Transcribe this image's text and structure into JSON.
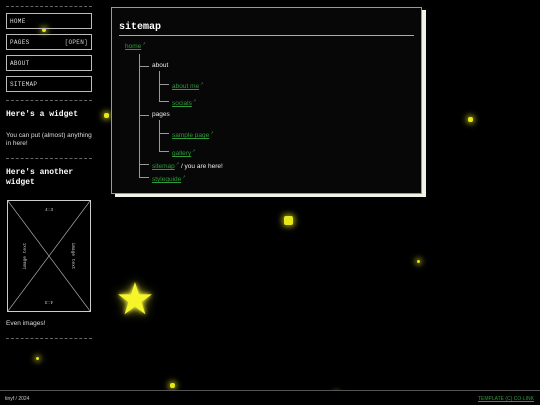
{
  "sidebar": {
    "nav": [
      {
        "label": "HOME",
        "tag": ""
      },
      {
        "label": "PAGES",
        "tag": "[OPEN]"
      },
      {
        "label": "ABOUT",
        "tag": ""
      },
      {
        "label": "SITEMAP",
        "tag": ""
      }
    ],
    "widget1": {
      "title": "Here's a widget",
      "text": "You can put (almost) anything in here!"
    },
    "widget2": {
      "title": "Here's another widget",
      "image": {
        "ratio_top": "4:3",
        "ratio_bottom": "4:3",
        "side_left": "image text",
        "side_right": "image text"
      },
      "text": "Even images!"
    }
  },
  "main": {
    "title": "sitemap",
    "ext_mark": "↗",
    "tree": {
      "home": "home",
      "about": "about",
      "about_me": "about me",
      "socials": "socials",
      "pages": "pages",
      "sample_page": "sample page",
      "gallery": "gallery",
      "sitemap": "sitemap",
      "you_are_here": "/ you are here!",
      "styleguide": "styleguide"
    }
  },
  "footer": {
    "left": "tinyf / 2024",
    "right": "TEMPLATE (C) CO-LINK"
  },
  "colors": {
    "link": "#2f9a3a",
    "sparkle": "#e6e61a",
    "card_shadow": "#f2f2e6"
  }
}
